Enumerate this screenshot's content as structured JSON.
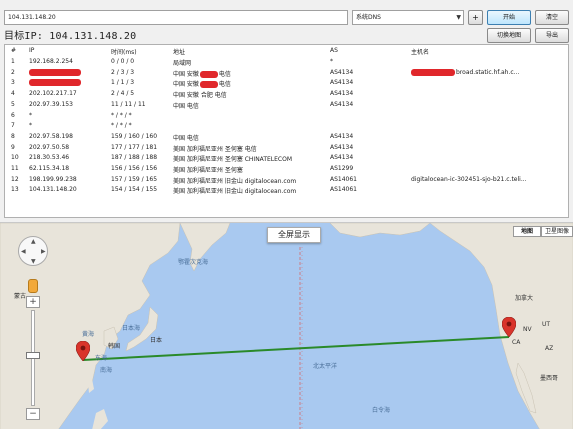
{
  "toolbar": {
    "target_input_value": "104.131.148.20",
    "dns_select_value": "系统DNS",
    "add_label": "+",
    "start_label": "开始",
    "clear_label": "清空",
    "switch_map_label": "切换地图",
    "export_label": "导出",
    "target_ip_text": "目标IP: 104.131.148.20"
  },
  "table": {
    "headers": [
      "#",
      "IP",
      "时间(ms)",
      "地址",
      "AS",
      "主机名"
    ],
    "rows": [
      {
        "idx": "1",
        "ip": "192.168.2.254",
        "time": "0 / 0 / 0",
        "loc": "局域网",
        "as": "*",
        "host": ""
      },
      {
        "idx": "2",
        "ip": "",
        "time": "2 / 3 / 3",
        "loc": "中国 安徽",
        "loc_suffix": "电信",
        "as": "AS4134",
        "host": "broad.static.hf.ah.c..."
      },
      {
        "idx": "3",
        "ip": "",
        "time": "1 / 1 / 3",
        "loc": "中国 安徽",
        "loc_suffix": "电信",
        "as": "AS4134",
        "host": ""
      },
      {
        "idx": "4",
        "ip": "202.102.217.17",
        "time": "2 / 4 / 5",
        "loc": "中国 安徽 合肥 电信",
        "as": "AS4134",
        "host": ""
      },
      {
        "idx": "5",
        "ip": "202.97.39.153",
        "time": "11 / 11 / 11",
        "loc": "中国 电信",
        "as": "AS4134",
        "host": ""
      },
      {
        "idx": "6",
        "ip": "*",
        "time": "* / * / *",
        "loc": "",
        "as": "",
        "host": ""
      },
      {
        "idx": "7",
        "ip": "*",
        "time": "* / * / *",
        "loc": "",
        "as": "",
        "host": ""
      },
      {
        "idx": "8",
        "ip": "202.97.58.198",
        "time": "159 / 160 / 160",
        "loc": "中国 电信",
        "as": "AS4134",
        "host": ""
      },
      {
        "idx": "9",
        "ip": "202.97.50.58",
        "time": "177 / 177 / 181",
        "loc": "美国 加利福尼亚州 圣何塞 电信",
        "as": "AS4134",
        "host": ""
      },
      {
        "idx": "10",
        "ip": "218.30.53.46",
        "time": "187 / 188 / 188",
        "loc": "美国 加利福尼亚州 圣何塞 CHINATELECOM",
        "as": "AS4134",
        "host": ""
      },
      {
        "idx": "11",
        "ip": "62.115.34.18",
        "time": "156 / 156 / 156",
        "loc": "美国 加利福尼亚州 圣何塞",
        "as": "AS1299",
        "host": ""
      },
      {
        "idx": "12",
        "ip": "198.199.99.238",
        "time": "157 / 159 / 165",
        "loc": "美国 加利福尼亚州 旧金山 digitalocean.com",
        "as": "AS14061",
        "host": "digitalocean-ic-302451-sjo-b21.c.teli..."
      },
      {
        "idx": "13",
        "ip": "104.131.148.20",
        "time": "154 / 154 / 155",
        "loc": "美国 加利福尼亚州 旧金山 digitalocean.com",
        "as": "AS14061",
        "host": ""
      }
    ]
  },
  "map": {
    "fullscreen_label": "全屏显示",
    "map_type_map": "地图",
    "map_type_satellite": "卫星图像",
    "labels": {
      "okhotsk": "鄂霍次克海",
      "japan_sea": "日本海",
      "korea": "韩国",
      "japan": "日本",
      "east_sea": "东海",
      "yellow_sea": "黄海",
      "nanhai": "南海",
      "north_pacific": "北太平洋",
      "bering": "白令海",
      "canada": "加拿大",
      "mongolia": "蒙古",
      "nv": "NV",
      "ca": "CA",
      "ut": "UT",
      "az": "AZ",
      "mexico": "墨西哥"
    },
    "colors": {
      "water": "#a9c9f0",
      "land": "#e8e4da",
      "route": "#2a8a2a",
      "marker": "#d9342b",
      "dateline": "#d46a6a"
    }
  }
}
